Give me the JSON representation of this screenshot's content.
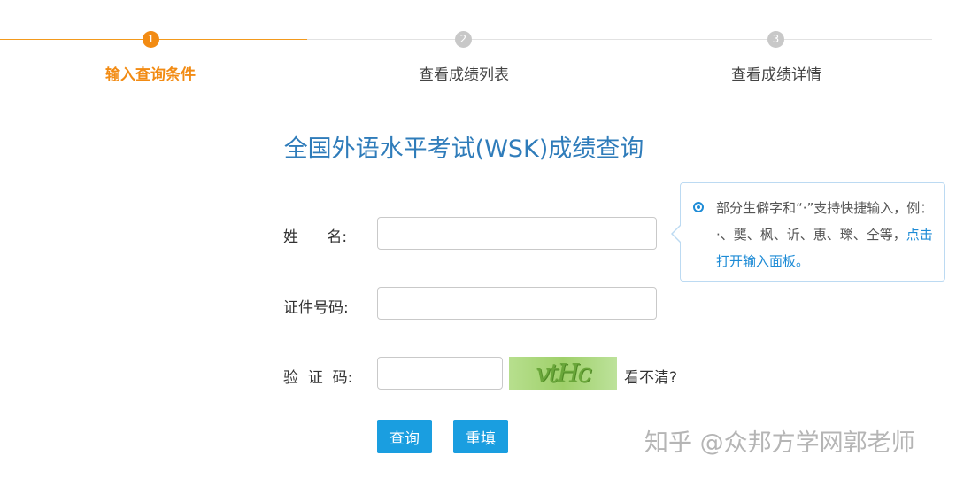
{
  "steps": [
    {
      "number": "1",
      "label": "输入查询条件",
      "state": "active"
    },
    {
      "number": "2",
      "label": "查看成绩列表",
      "state": "inactive"
    },
    {
      "number": "3",
      "label": "查看成绩详情",
      "state": "inactive"
    }
  ],
  "page_title": "全国外语水平考试(WSK)成绩查询",
  "form": {
    "name_label": "姓      名:",
    "name_value": "",
    "id_label": "证件号码:",
    "id_value": "",
    "captcha_label": "验  证  码:",
    "captcha_value": "",
    "captcha_text": "vtHc",
    "captcha_refresh": "看不清?",
    "query_button": "查询",
    "reset_button": "重填"
  },
  "tip": {
    "text": "部分生僻字和“·”支持快捷输入，例：·、龑、枫、䜣、恵、瓅、仝等，",
    "link": "点击打开输入面板。"
  },
  "watermark": "知乎 @众邦方学网郭老师",
  "colors": {
    "active_step": "#f28b13",
    "title": "#2f7cba",
    "button": "#1a9ee0",
    "tip_border": "#bcdaf2",
    "link": "#1d8bd6"
  }
}
